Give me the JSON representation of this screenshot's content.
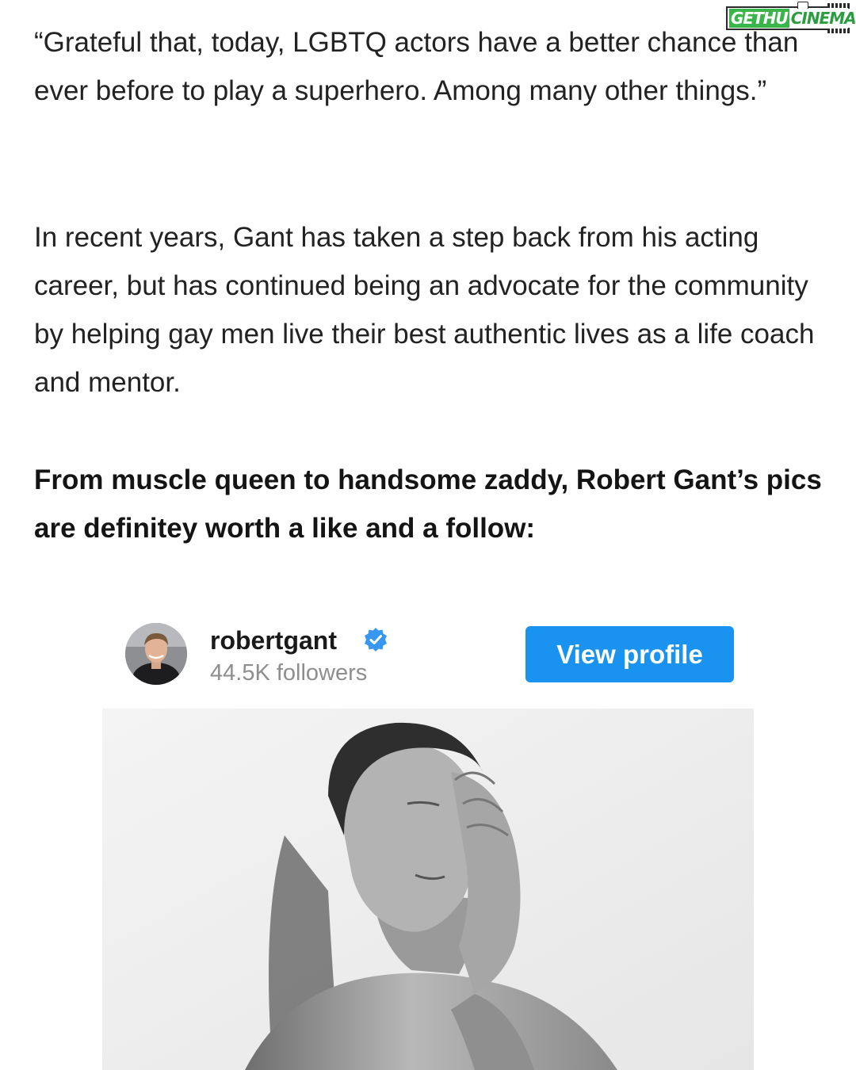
{
  "watermark": {
    "part1": "GETHU",
    "part2": "CINEMA"
  },
  "article": {
    "quote": "“Grateful that, today, LGBTQ actors have a better chance than ever before to play a superhero. Among many other things.”",
    "paragraph": "In recent years, Gant has taken a step back from his acting career,  but has continued being an advocate for the community by helping gay men live their best authentic lives as a life coach and mentor.",
    "callout": "From muscle queen to handsome zaddy, Robert Gant’s pics are definitey worth a like and a follow:"
  },
  "embed": {
    "username": "robertgant",
    "followers": "44.5K followers",
    "view_profile_label": "View profile",
    "button_color": "#1a93f0",
    "verified_color": "#3897f0"
  }
}
